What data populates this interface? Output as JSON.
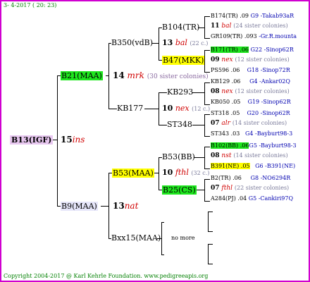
{
  "header": "3- 4-2017 ( 20: 23)",
  "footer": "Copyright 2004-2017 @ Karl Kehrle Foundation.   www.pedigreeapis.org",
  "colors": {
    "border": "#d000d0",
    "green_hl": "#1ee61e",
    "yellow_hl": "#ffff00",
    "sister_red": "#d00000"
  },
  "gen1": {
    "name": "B13(IGF)",
    "num": "15",
    "tag": "ins"
  },
  "gen2": {
    "upper": {
      "name": "B21(MAA)",
      "num": "14",
      "tag": "mrk",
      "sis": "(30 sister colonies)"
    },
    "lower": {
      "name": "B9(MAA)",
      "num": "13",
      "tag": "nat"
    }
  },
  "gen3": {
    "a": {
      "name": "B350(vdB)",
      "num": "13",
      "tag": "bal",
      "sis": "(22 c.)"
    },
    "b": {
      "name": "KB177",
      "num": "10",
      "tag": "nex",
      "sis": "(12 c.)"
    },
    "c": {
      "name": "B53(MAA)",
      "num": "10",
      "tag": "fthl",
      "sis": "(32 c.)"
    },
    "d": {
      "name": "Bxx15(MAA)",
      "nomore": "no more"
    }
  },
  "gen4": {
    "a1": "B104(TR)",
    "a2": "B47(MKK)",
    "b1": "KB293",
    "b2": "ST348",
    "c1": "B53(BB)",
    "c2": "B25(CS)"
  },
  "gen5": [
    {
      "l1": "B174(TR) .09",
      "l1b": "G9 -Takab93aR",
      "num": "11",
      "tag": "bal",
      "sis": "(24 sister colonies)",
      "l3": "GR109(TR) .093",
      "l3b": "-Gr.R.mounta"
    },
    {
      "l1": "B171(TR) .06",
      "l1b": "G22 -Sinop62R",
      "num": "09",
      "tag": "nex",
      "sis": "(12 sister colonies)",
      "l3": "PS596 .06",
      "l3b": "G18 -Sinop72R"
    },
    {
      "l1": "KB129 .06",
      "l1b": "G4 -Ankar02Q",
      "num": "08",
      "tag": "nex",
      "sis": "(12 sister colonies)",
      "l3": "KB050 .05",
      "l3b": "G19 -Sinop62R"
    },
    {
      "l1": "ST318 .05",
      "l1b": "G20 -Sinop62R",
      "num": "07",
      "tag": "alr",
      "sis": "(14 sister colonies)",
      "l3": "ST343 .03",
      "l3b": "G4 -Bayburt98-3"
    },
    {
      "l1": "B102(BB) .06",
      "l1b": "G5 -Bayburt98-3",
      "num": "08",
      "tag": "nst",
      "sis": "(14 sister colonies)",
      "l3": "B391(NE) .05",
      "l3b": "G6 -B391(NE)"
    },
    {
      "l1": "B2(TR) .06",
      "l1b": "G8 -NO6294R",
      "num": "07",
      "tag": "fthl",
      "sis": "(22 sister colonies)",
      "l3": "A284(PJ) .04",
      "l3b": "G5 -Cankiri97Q"
    }
  ]
}
